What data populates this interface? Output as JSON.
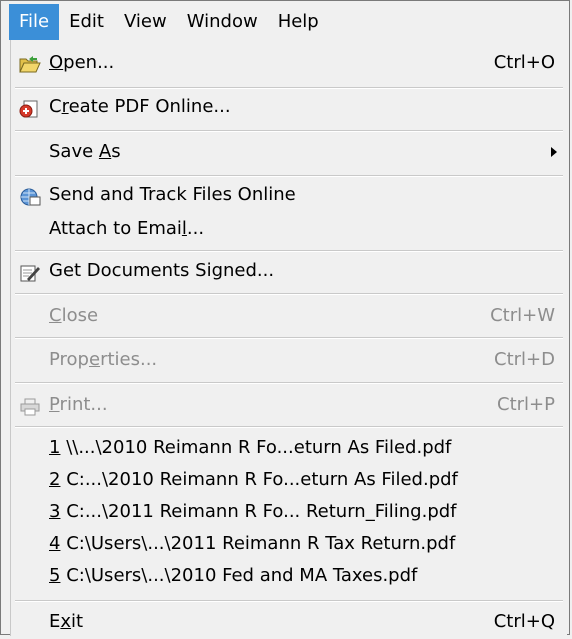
{
  "menubar": {
    "items": [
      "File",
      "Edit",
      "View",
      "Window",
      "Help"
    ]
  },
  "file_menu": {
    "open": {
      "label": "Open...",
      "shortcut": "Ctrl+O"
    },
    "create_pdf": {
      "label": "Create PDF Online..."
    },
    "save_as": {
      "label": "Save As"
    },
    "send_track": {
      "label": "Send and Track Files Online"
    },
    "attach_email": {
      "label": "Attach to Email..."
    },
    "get_signed": {
      "label": "Get Documents Signed..."
    },
    "close": {
      "label": "Close",
      "shortcut": "Ctrl+W"
    },
    "properties": {
      "label": "Properties...",
      "shortcut": "Ctrl+D"
    },
    "print": {
      "label": "Print...",
      "shortcut": "Ctrl+P"
    },
    "recent_files": [
      {
        "num": "1",
        "path": "\\\\...\\2010 Reimann R Fo...eturn As Filed.pdf"
      },
      {
        "num": "2",
        "path": "C:...\\2010 Reimann R Fo...eturn As Filed.pdf"
      },
      {
        "num": "3",
        "path": "C:...\\2011 Reimann R Fo... Return_Filing.pdf"
      },
      {
        "num": "4",
        "path": "C:\\Users\\...\\2011 Reimann R Tax Return.pdf"
      },
      {
        "num": "5",
        "path": "C:\\Users\\...\\2010 Fed and MA Taxes.pdf"
      }
    ],
    "exit": {
      "label": "Exit",
      "shortcut": "Ctrl+Q"
    }
  },
  "colors": {
    "highlight": "#3b8fd8",
    "disabled": "#8d8d8d"
  }
}
